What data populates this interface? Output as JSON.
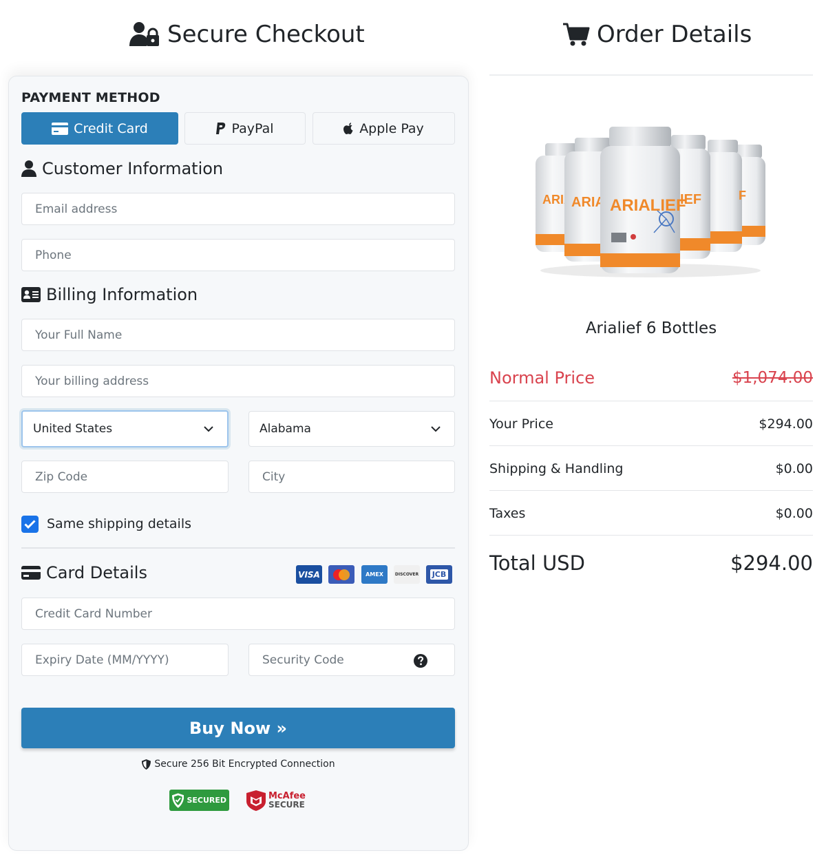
{
  "checkout": {
    "title": "Secure Checkout",
    "payment_method_label": "PAYMENT METHOD",
    "payment_methods": [
      {
        "label": "Credit Card",
        "active": true
      },
      {
        "label": "PayPal",
        "active": false
      },
      {
        "label": "Apple Pay",
        "active": false
      }
    ],
    "customer_section_title": "Customer Information",
    "email_placeholder": "Email address",
    "phone_placeholder": "Phone",
    "billing_section_title": "Billing Information",
    "full_name_placeholder": "Your Full Name",
    "address_placeholder": "Your billing address",
    "country_value": "United States",
    "state_value": "Alabama",
    "zip_placeholder": "Zip Code",
    "city_placeholder": "City",
    "same_shipping_label": "Same shipping details",
    "same_shipping_checked": true,
    "card_section_title": "Card Details",
    "card_logos": [
      "VISA",
      "MasterCard",
      "AMEX",
      "DISCOVER",
      "JCB"
    ],
    "card_number_placeholder": "Credit Card Number",
    "expiry_placeholder": "Expiry Date (MM/YYYY)",
    "security_code_placeholder": "Security Code",
    "buy_button_label": "Buy Now »",
    "secure_connection_text": "Secure 256 Bit Encrypted Connection",
    "badges": {
      "trust": "SECURED",
      "mcafee_top": "McAfee",
      "mcafee_bottom": "SECURE"
    },
    "accent_color": "#2c7fb8"
  },
  "order": {
    "title": "Order Details",
    "product_name": "Arialief 6 Bottles",
    "product_label_text": "ARIALIEF",
    "normal_price_label": "Normal Price",
    "normal_price_value": "$1,074.00",
    "your_price_label": "Your Price",
    "your_price_value": "$294.00",
    "shipping_label": "Shipping & Handling",
    "shipping_value": "$0.00",
    "taxes_label": "Taxes",
    "taxes_value": "$0.00",
    "total_label": "Total USD",
    "total_value": "$294.00",
    "normal_price_color": "#d9434e"
  }
}
